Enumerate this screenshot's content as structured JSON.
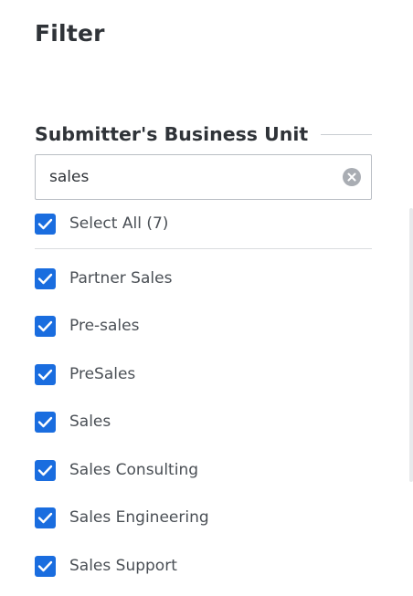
{
  "filter": {
    "title": "Filter",
    "section_title": "Submitter's Business Unit",
    "search": {
      "value": "sales",
      "clear_icon": "clear-circle-icon"
    },
    "select_all": {
      "label": "Select All (7)",
      "checked": true
    },
    "options": [
      {
        "label": "Partner Sales",
        "checked": true
      },
      {
        "label": "Pre-sales",
        "checked": true
      },
      {
        "label": "PreSales",
        "checked": true
      },
      {
        "label": "Sales",
        "checked": true
      },
      {
        "label": "Sales Consulting",
        "checked": true
      },
      {
        "label": "Sales Engineering",
        "checked": true
      },
      {
        "label": "Sales Support",
        "checked": true
      }
    ],
    "colors": {
      "checkbox_accent": "#1a6ddf",
      "clear_button": "#a9adb3"
    }
  }
}
